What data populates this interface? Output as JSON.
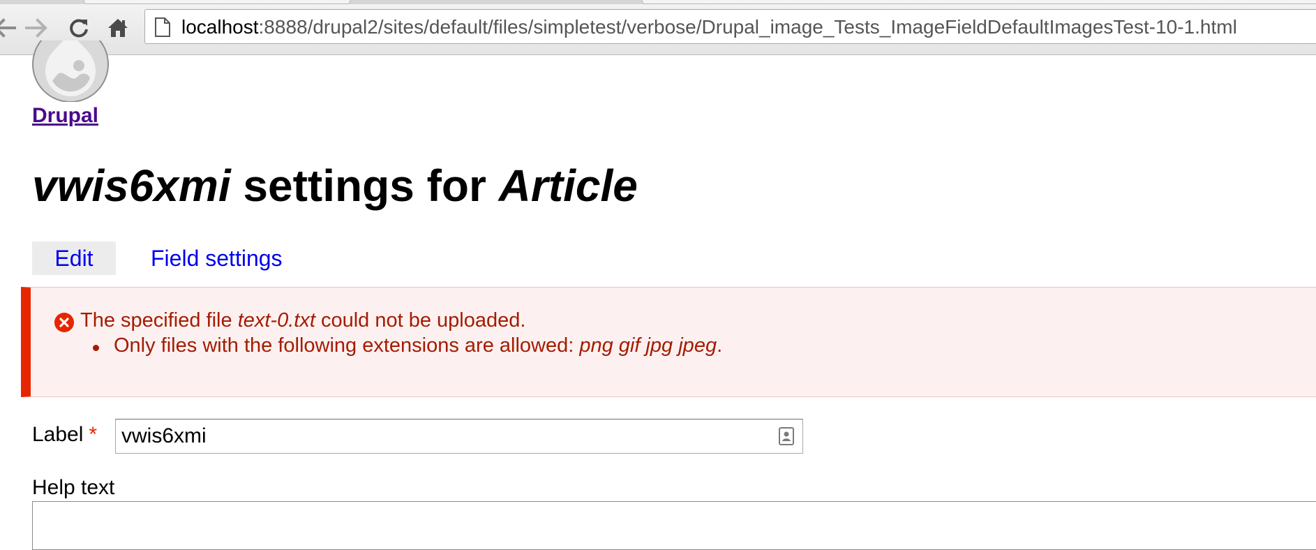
{
  "browser": {
    "url_host": "localhost",
    "url_rest": ":8888/drupal2/sites/default/files/simpletest/verbose/Drupal_image_Tests_ImageFieldDefaultImagesTest-10-1.html",
    "back_icon": "back-arrow-icon",
    "forward_icon": "forward-arrow-icon",
    "reload_icon": "reload-icon",
    "home_icon": "home-icon"
  },
  "site": {
    "name": "Drupal",
    "logo_icon": "drupal-drop-icon"
  },
  "page": {
    "title_field": "vwis6xmi",
    "title_middle": "settings for",
    "title_type": "Article"
  },
  "tabs": [
    {
      "label": "Edit",
      "active": true
    },
    {
      "label": "Field settings",
      "active": false
    }
  ],
  "message": {
    "type": "error",
    "icon": "error-x-icon",
    "color": "#a51b00",
    "main_prefix": "The specified file",
    "main_file": "text-0.txt",
    "main_suffix": "could not be uploaded.",
    "detail_prefix": "Only files with the following extensions are allowed:",
    "detail_extensions": "png gif jpg jpeg",
    "detail_suffix": "."
  },
  "form": {
    "label_field": {
      "label": "Label",
      "required_marker": "*",
      "value": "vwis6xmi"
    },
    "help_text": {
      "label": "Help text",
      "value": ""
    }
  }
}
